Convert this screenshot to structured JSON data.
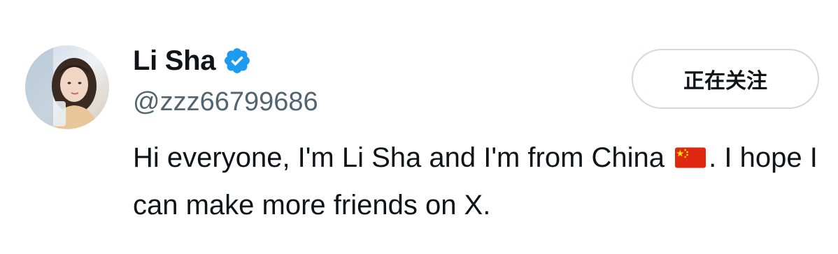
{
  "profile": {
    "display_name": "Li Sha",
    "verified_icon": "verified-badge-icon",
    "handle": "@zzz66799686",
    "follow_button_label": "正在关注",
    "bio_part1": "Hi everyone, I'm Li Sha and I'm from China",
    "bio_flag_icon": "china-flag-icon",
    "bio_part2": ". I hope I can make more friends on X."
  },
  "colors": {
    "verified_blue": "#1d9bf0",
    "handle_gray": "#536471",
    "button_border": "#cfd9de",
    "flag_red": "#de2910",
    "flag_yellow": "#ffde00"
  }
}
